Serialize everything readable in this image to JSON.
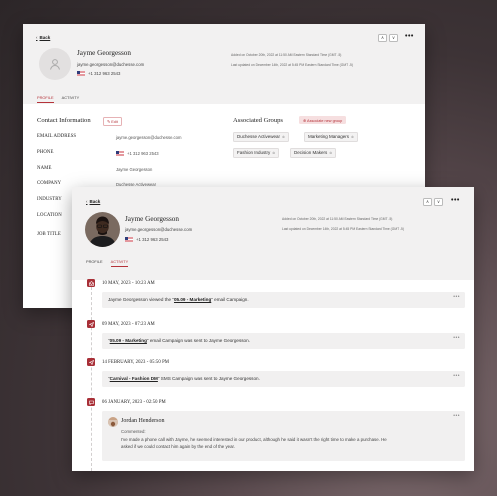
{
  "back_link": "Back",
  "back_panel": {
    "profile": {
      "name": "Jayme Georgesson",
      "email": "jayme.georgesson@duchesse.com",
      "phone": "+1 312 963 2543",
      "added": "Added on October 20th, 2022 at 11:50 AM Eastern Standard Time (GMT -5)",
      "updated": "Last updated on December 14th, 2022 at 5:45 PM Eastern Standard Time (GMT -5)"
    },
    "tabs": [
      "PROFILE",
      "ACTIVITY"
    ],
    "contact": {
      "title": "Contact Information",
      "edit_label": "Edit",
      "rows": [
        {
          "label": "EMAIL ADDRESS",
          "value": "jayme.georgesson@duchesse.com"
        },
        {
          "label": "PHONE",
          "value": "+1 312 963 2543"
        },
        {
          "label": "NAME",
          "value": "Jayme Georgesson"
        },
        {
          "label": "COMPANY",
          "value": "Duchesse Activewear"
        },
        {
          "label": "INDUSTRY",
          "value": ""
        },
        {
          "label": "LOCATION",
          "value": ""
        },
        {
          "label": "JOB TITLE",
          "value": ""
        }
      ]
    },
    "groups": {
      "title": "Associated Groups",
      "associate_label": "Associate new group",
      "tags": [
        "Duchesse Activewear",
        "Marketing Managers",
        "Fashion Industry",
        "Decision Makers"
      ]
    }
  },
  "front_panel": {
    "profile": {
      "name": "Jayme Georgesson",
      "email": "jayme.georgesson@duchesse.com",
      "phone": "+1 312 963 2543",
      "added": "Added on October 20th, 2022 at 11:50 AM Eastern Standard Time (GMT -5)",
      "updated": "Last updated on December 14th, 2022 at 5:45 PM Eastern Standard Time (GMT -5)"
    },
    "tabs": [
      "PROFILE",
      "ACTIVITY"
    ],
    "active_tab": "ACTIVITY",
    "activity": [
      {
        "date": "10 MAY, 2023 - 10:23 AM",
        "before": "Jayme Georgesson viewed the \"",
        "link": "05.09 - Marketing",
        "after": "\" email Campaign.",
        "icon": "email-open-icon"
      },
      {
        "date": "09 MAY, 2023 - 07:23 AM",
        "before": "\"",
        "link": "05.09 - Marketing",
        "after": "\" email Campaign was sent to Jayme Georgesson.",
        "icon": "email-sent-icon"
      },
      {
        "date": "14 FEBRUARY, 2023 - 05:50 PM",
        "before": "\"",
        "link": "Carnival - Fashion DM",
        "after": "\" SMS Campaign was sent to Jayme Georgesson.",
        "icon": "sms-sent-icon"
      },
      {
        "date": "06 JANUARY, 2023 - 02:50 PM",
        "icon": "comment-icon"
      }
    ],
    "comment": {
      "author": "Jordan Henderson",
      "label": "Commented:",
      "line1": "I've made a phone call with Jayme, he seemed interested in our product, although he said it wasn't the right time to make a purchase. He",
      "line2": "asked if we could contact him again by the end of the year."
    }
  },
  "colors": {
    "accent": "#b5333a",
    "icon_bg": "#a82f37",
    "header_bg": "#f2f1f1"
  }
}
